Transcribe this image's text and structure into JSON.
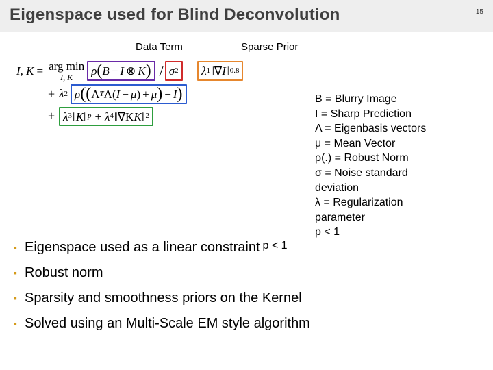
{
  "page_number": "15",
  "title": "Eigenspace used for Blind Deconvolution",
  "annotations": {
    "data_term": "Data Term",
    "sparse_prior": "Sparse Prior"
  },
  "eq": {
    "lhs_I": "I",
    "lhs_K": "K",
    "argmin": "arg min",
    "argmin_sub": "I, K",
    "rho": "ρ",
    "B": "B",
    "minus": "−",
    "otimes": "⊗",
    "sigma": "σ",
    "sq": "2",
    "plus": "+",
    "lambda": "λ",
    "one": "1",
    "nabla": "∇",
    "I2": "I",
    "p08": "0.8",
    "l2": "2",
    "LambdaT": "Λ",
    "Tsup": "T",
    "mu": "μ",
    "l3": "3",
    "Kp_p": "p",
    "l4": "4",
    "nablaK": "∇K",
    "sq2": "2"
  },
  "legend": {
    "B": "B = Blurry Image",
    "I": "I = Sharp Prediction",
    "Lambda": "Λ = Eigenbasis vectors",
    "mu": "μ = Mean Vector",
    "rho": "ρ(.) = Robust Norm",
    "sigma": "σ = Noise standard",
    "sigma2": "deviation",
    "lambda": "λ = Regularization",
    "lambda2": "parameter",
    "p": "p < 1"
  },
  "bullets": {
    "b1": "Eigenspace used as a linear constraint",
    "b2": "Robust norm",
    "b3": "Sparsity and smoothness priors on the Kernel",
    "b4": "Solved using an Multi-Scale EM style algorithm"
  }
}
